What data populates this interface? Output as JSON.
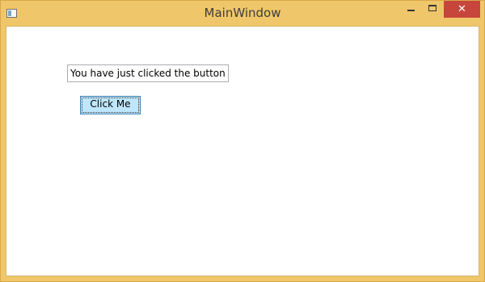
{
  "window": {
    "title": "MainWindow",
    "controls": {
      "minimize_icon": "minimize-icon",
      "maximize_icon": "maximize-icon",
      "close_icon": "close-icon",
      "close_glyph": "✕"
    },
    "colors": {
      "frame": "#f0c66a",
      "close_button": "#c7463b",
      "button_fill": "#bee6fd",
      "button_border": "#3c7fb1"
    }
  },
  "main": {
    "textbox_value": "You have just clicked the button",
    "button_label": "Click Me"
  }
}
